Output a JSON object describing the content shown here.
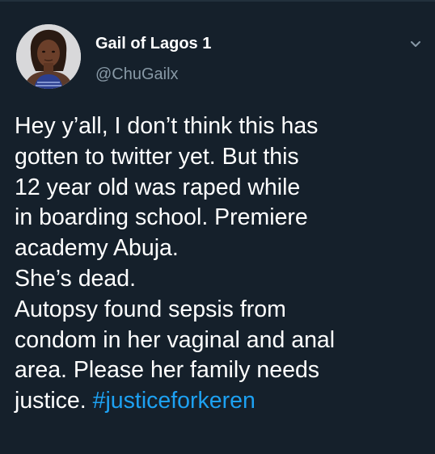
{
  "tweet": {
    "display_name": "Gail of Lagos 1",
    "handle": "@ChuGailx",
    "text_lines": [
      "Hey y’all, I don’t think this has",
      "gotten to twitter yet. But this",
      "12 year old was raped while",
      "in boarding school. Premiere",
      "academy Abuja.",
      "She’s dead.",
      "Autopsy found sepsis from",
      "condom in her vaginal and anal",
      "area. Please her family needs",
      "justice."
    ],
    "hashtag": "#justiceforkeren"
  },
  "icons": {
    "avatar": "user-photo",
    "menu": "chevron-down-icon"
  },
  "colors": {
    "background": "#15202b",
    "text": "#ffffff",
    "secondary_text": "#8899a6",
    "link": "#1da1f2"
  }
}
